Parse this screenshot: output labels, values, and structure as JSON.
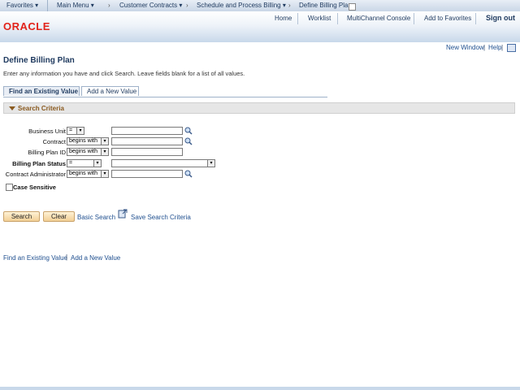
{
  "breadcrumb": {
    "favorites": "Favorites",
    "main_menu": "Main Menu",
    "customer_contracts": "Customer Contracts",
    "schedule_billing": "Schedule and Process Billing",
    "current": "Define Billing Plan"
  },
  "header": {
    "logo": "ORACLE",
    "home": "Home",
    "worklist": "Worklist",
    "multichannel": "MultiChannel Console",
    "add_favorites": "Add to Favorites",
    "sign_out": "Sign out"
  },
  "toplinks": {
    "new_window": "New Window",
    "help": "Help"
  },
  "page": {
    "title": "Define Billing Plan",
    "instructions": "Enter any information you have and click Search. Leave fields blank for a list of all values."
  },
  "tabs": {
    "find": "Find an Existing Value",
    "add": "Add a New Value"
  },
  "search": {
    "section_title": "Search Criteria",
    "fields": {
      "business_unit": {
        "label": "Business Unit",
        "op": "=",
        "value": ""
      },
      "contract": {
        "label": "Contract",
        "op": "begins with",
        "value": ""
      },
      "billing_plan_id": {
        "label": "Billing Plan ID",
        "op": "begins with",
        "value": ""
      },
      "billing_plan_status": {
        "label": "Billing Plan Status",
        "op": "=",
        "value": ""
      },
      "contract_admin": {
        "label": "Contract Administrator",
        "op": "begins with",
        "value": ""
      }
    },
    "case_sensitive": "Case Sensitive"
  },
  "actions": {
    "search": "Search",
    "clear": "Clear",
    "basic_search": "Basic Search",
    "save_criteria": "Save Search Criteria"
  },
  "footer": {
    "find": "Find an Existing Value",
    "add": "Add a New Value"
  }
}
